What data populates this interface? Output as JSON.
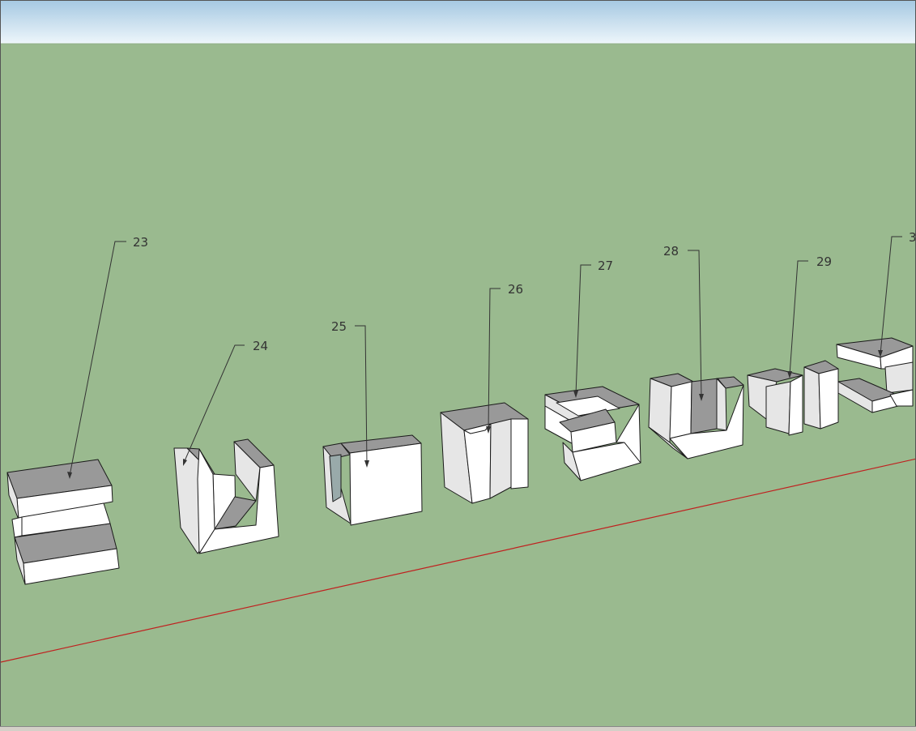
{
  "app": {
    "name": "SketchUp 3D model viewport"
  },
  "colors": {
    "sky_top": "#a6c9e2",
    "sky_bottom": "#eef6fb",
    "ground": "#9aba8f",
    "axis_red": "#c0201f",
    "face_white": "#ffffff",
    "face_light": "#e6e6e6",
    "face_shadow": "#b3b3b3",
    "face_dark": "#999999",
    "edge": "#1a1a1a",
    "leader": "#333333"
  },
  "callouts": [
    {
      "label": "23"
    },
    {
      "label": "24"
    },
    {
      "label": "25"
    },
    {
      "label": "26"
    },
    {
      "label": "27"
    },
    {
      "label": "28"
    },
    {
      "label": "29"
    },
    {
      "label": "3"
    }
  ]
}
